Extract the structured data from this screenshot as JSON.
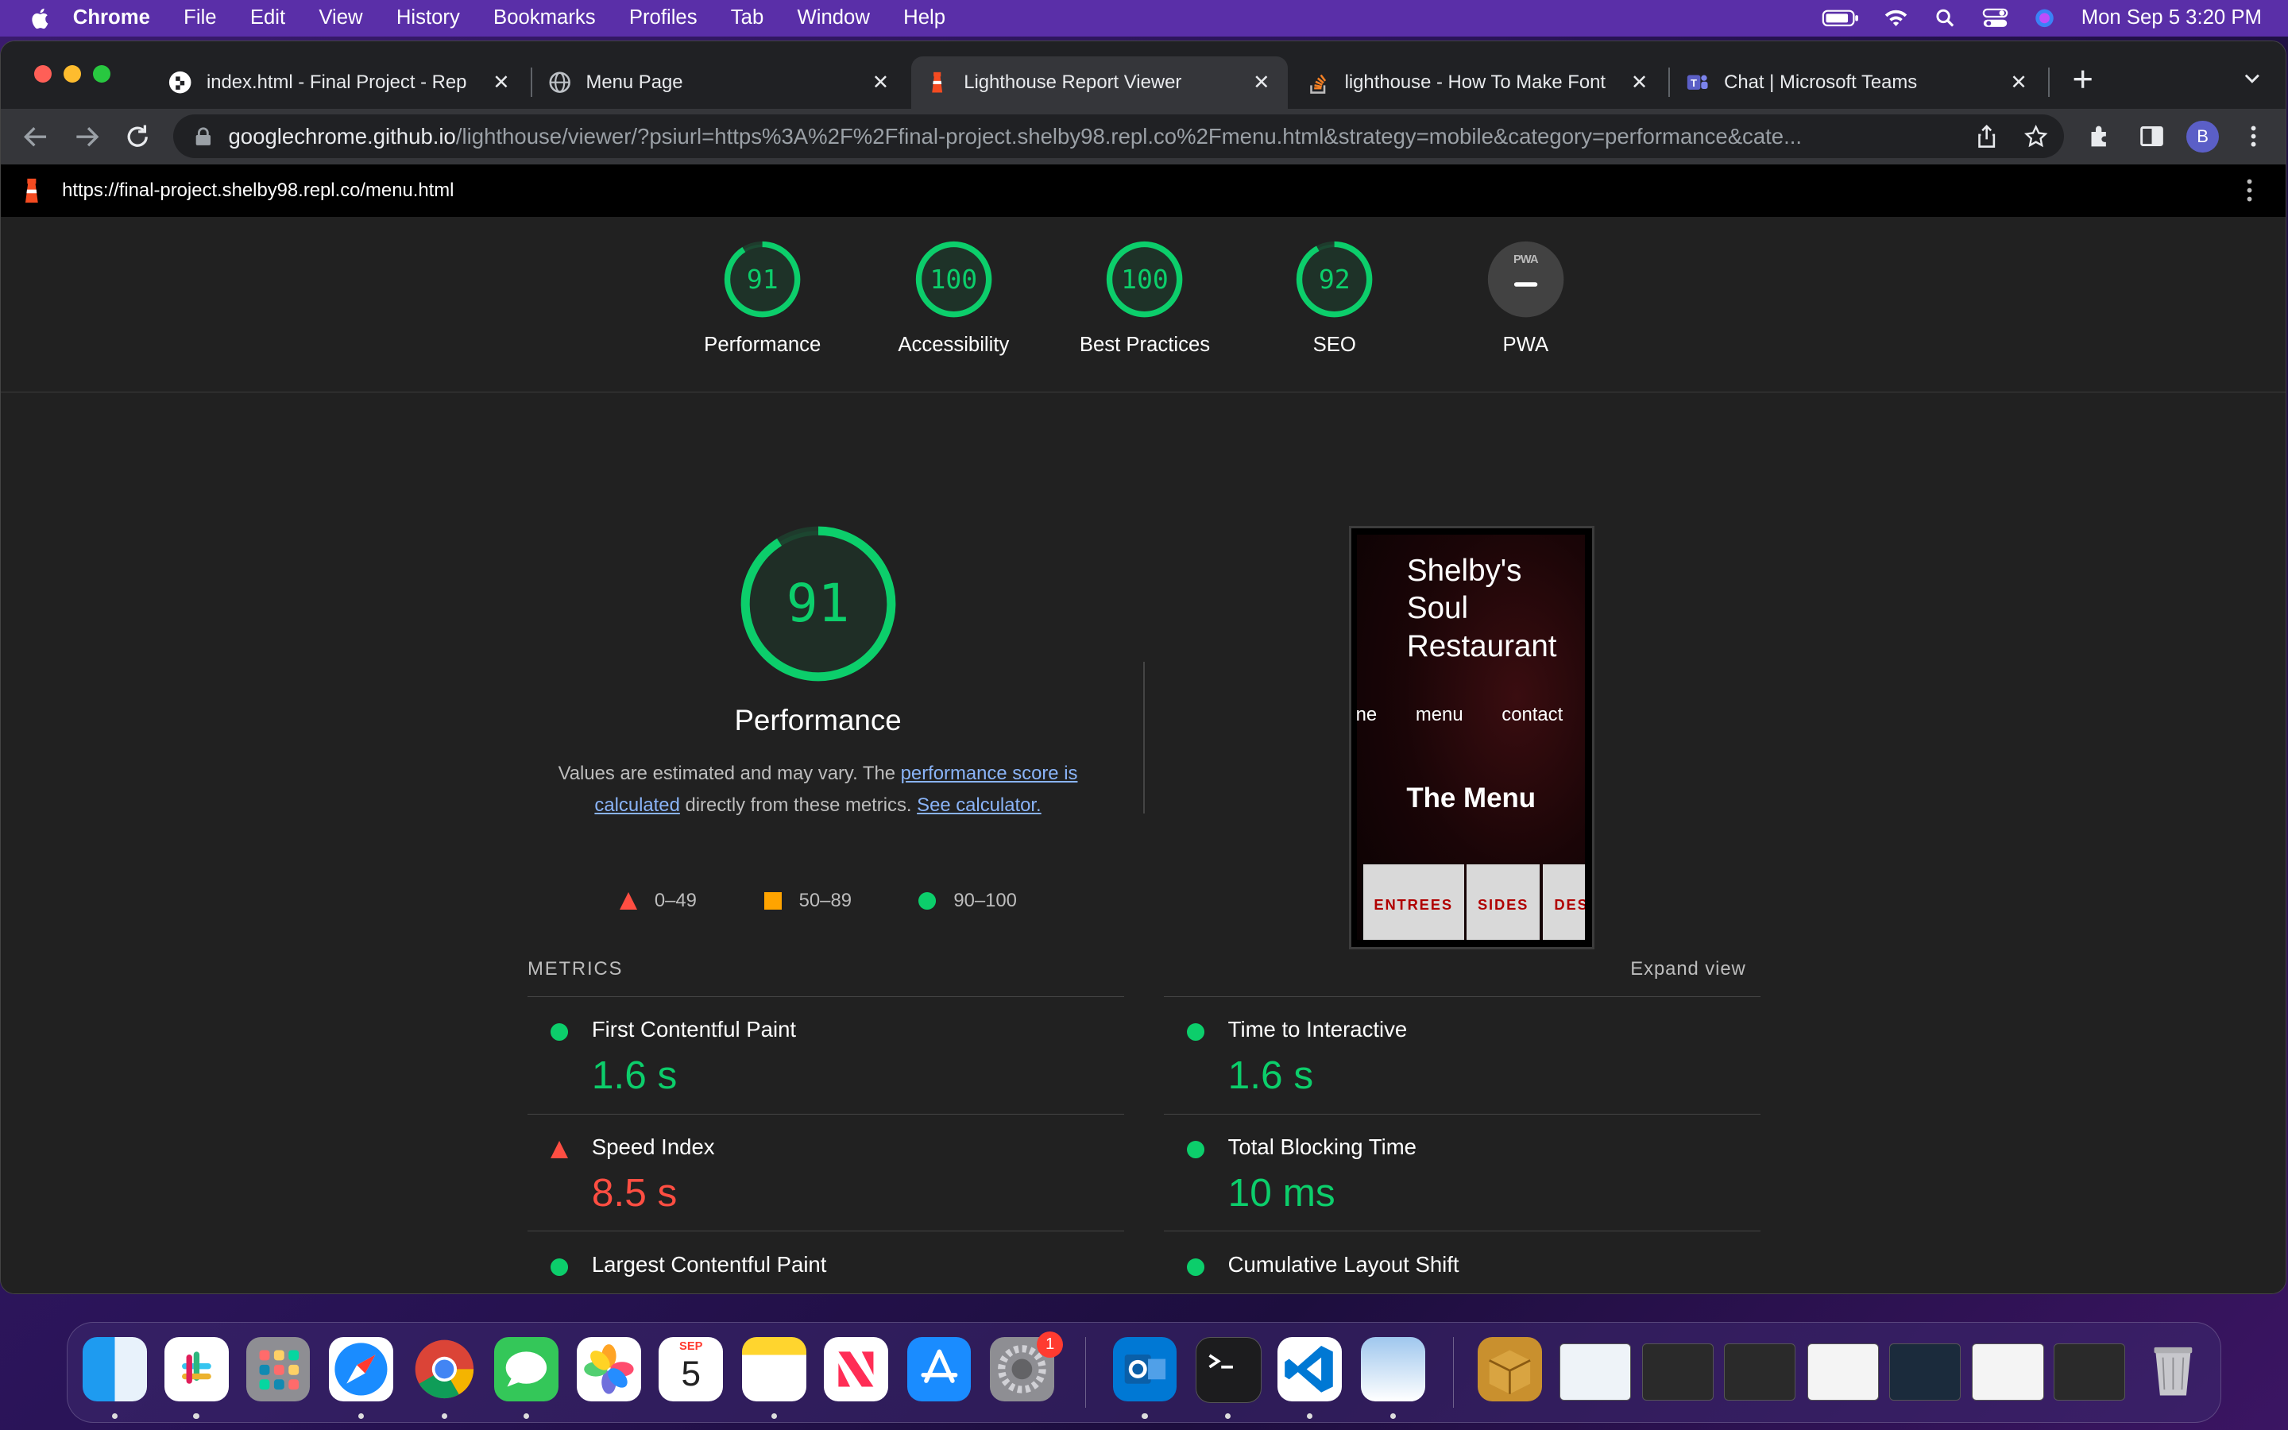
{
  "menubar": {
    "app": "Chrome",
    "items": [
      "File",
      "Edit",
      "View",
      "History",
      "Bookmarks",
      "Profiles",
      "Tab",
      "Window",
      "Help"
    ],
    "clock": "Mon Sep 5  3:20 PM"
  },
  "tabs": [
    {
      "title": "index.html - Final Project - Rep",
      "icon": "replit-icon"
    },
    {
      "title": "Menu Page",
      "icon": "globe-icon"
    },
    {
      "title": "Lighthouse Report Viewer",
      "icon": "lighthouse-icon",
      "active": true
    },
    {
      "title": "lighthouse - How To Make Font",
      "icon": "stackoverflow-icon"
    },
    {
      "title": "Chat | Microsoft Teams",
      "icon": "teams-icon"
    }
  ],
  "omnibox": {
    "host": "googlechrome.github.io",
    "path": "/lighthouse/viewer/?psiurl=https%3A%2F%2Ffinal-project.shelby98.repl.co%2Fmenu.html&strategy=mobile&category=performance&cate..."
  },
  "profile_initial": "B",
  "report_url": "https://final-project.shelby98.repl.co/menu.html",
  "categories": [
    {
      "score": "91",
      "label": "Performance",
      "fraction": 0.91
    },
    {
      "score": "100",
      "label": "Accessibility",
      "fraction": 1.0
    },
    {
      "score": "100",
      "label": "Best Practices",
      "fraction": 1.0
    },
    {
      "score": "92",
      "label": "SEO",
      "fraction": 0.92
    },
    {
      "score": "PWA",
      "label": "PWA"
    }
  ],
  "performance": {
    "score": "91",
    "fraction": 0.91,
    "title": "Performance",
    "desc_prefix": "Values are estimated and may vary. The ",
    "desc_link1": "performance score is calculated",
    "desc_mid": " directly from these metrics. ",
    "desc_link2": "See calculator."
  },
  "legend": [
    {
      "range": "0–49",
      "shape": "triangle",
      "color": "#ff4e42"
    },
    {
      "range": "50–89",
      "shape": "square",
      "color": "#ffa400"
    },
    {
      "range": "90–100",
      "shape": "circle",
      "color": "#0cce6b"
    }
  ],
  "screenshot": {
    "site_title_1": "Shelby's",
    "site_title_2": "Soul",
    "site_title_3": "Restaurant",
    "nav_home": "ne",
    "nav_menu": "menu",
    "nav_contact": "contact",
    "heading": "The Menu",
    "tabs": [
      "ENTREES",
      "SIDES",
      "DES"
    ]
  },
  "metrics_header": {
    "title": "METRICS",
    "expand": "Expand view"
  },
  "metrics": [
    {
      "name": "First Contentful Paint",
      "value": "1.6 s",
      "status": "pass"
    },
    {
      "name": "Time to Interactive",
      "value": "1.6 s",
      "status": "pass"
    },
    {
      "name": "Speed Index",
      "value": "8.5 s",
      "status": "fail"
    },
    {
      "name": "Total Blocking Time",
      "value": "10 ms",
      "status": "pass"
    },
    {
      "name": "Largest Contentful Paint",
      "value": "",
      "status": "pass"
    },
    {
      "name": "Cumulative Layout Shift",
      "value": "",
      "status": "pass"
    }
  ],
  "colors": {
    "pass": "#0cce6b",
    "average": "#ffa400",
    "fail": "#ff4e42",
    "accent": "#8ab4f8"
  },
  "dock": {
    "calendar_month": "SEP",
    "calendar_day": "5",
    "settings_badge": "1",
    "apps": [
      "finder",
      "slack",
      "launchpad",
      "safari",
      "chrome",
      "messages",
      "photos",
      "calendar",
      "notes",
      "news",
      "app-store",
      "system-preferences",
      "outlook",
      "terminal",
      "vscode",
      "preview",
      "archive-utility",
      "trash"
    ]
  }
}
